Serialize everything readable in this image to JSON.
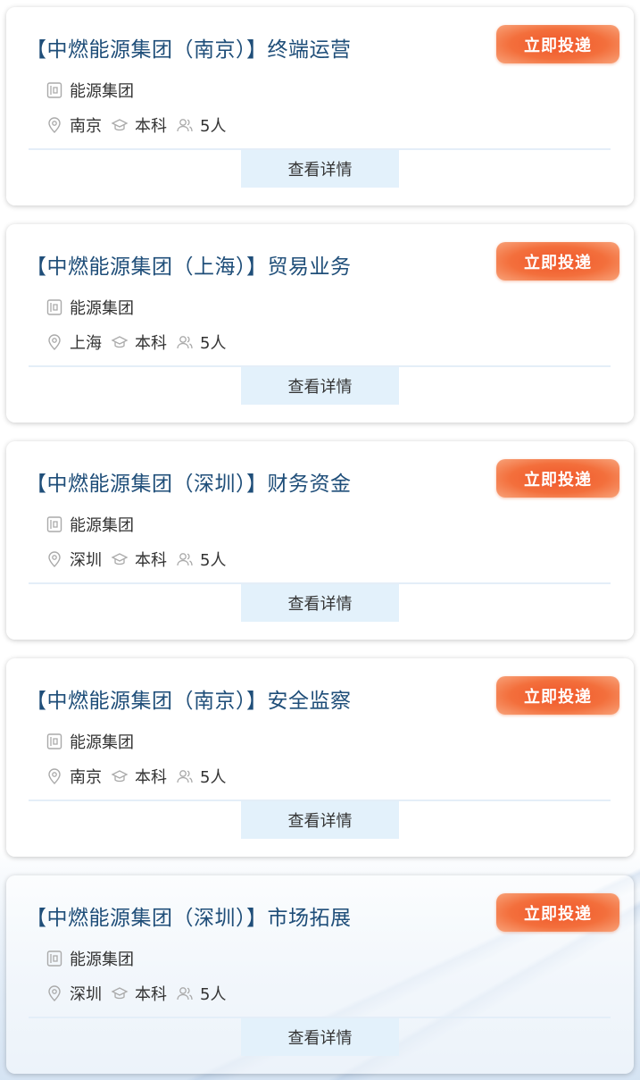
{
  "apply_label": "立即投递",
  "detail_label": "查看详情",
  "jobs": [
    {
      "title": "【中燃能源集团（南京）】终端运营",
      "company": "能源集团",
      "location": "南京",
      "education": "本科",
      "headcount": "5人"
    },
    {
      "title": "【中燃能源集团（上海）】贸易业务",
      "company": "能源集团",
      "location": "上海",
      "education": "本科",
      "headcount": "5人"
    },
    {
      "title": "【中燃能源集团（深圳）】财务资金",
      "company": "能源集团",
      "location": "深圳",
      "education": "本科",
      "headcount": "5人"
    },
    {
      "title": "【中燃能源集团（南京）】安全监察",
      "company": "能源集团",
      "location": "南京",
      "education": "本科",
      "headcount": "5人"
    },
    {
      "title": "【中燃能源集团（深圳）】市场拓展",
      "company": "能源集团",
      "location": "深圳",
      "education": "本科",
      "headcount": "5人"
    }
  ]
}
